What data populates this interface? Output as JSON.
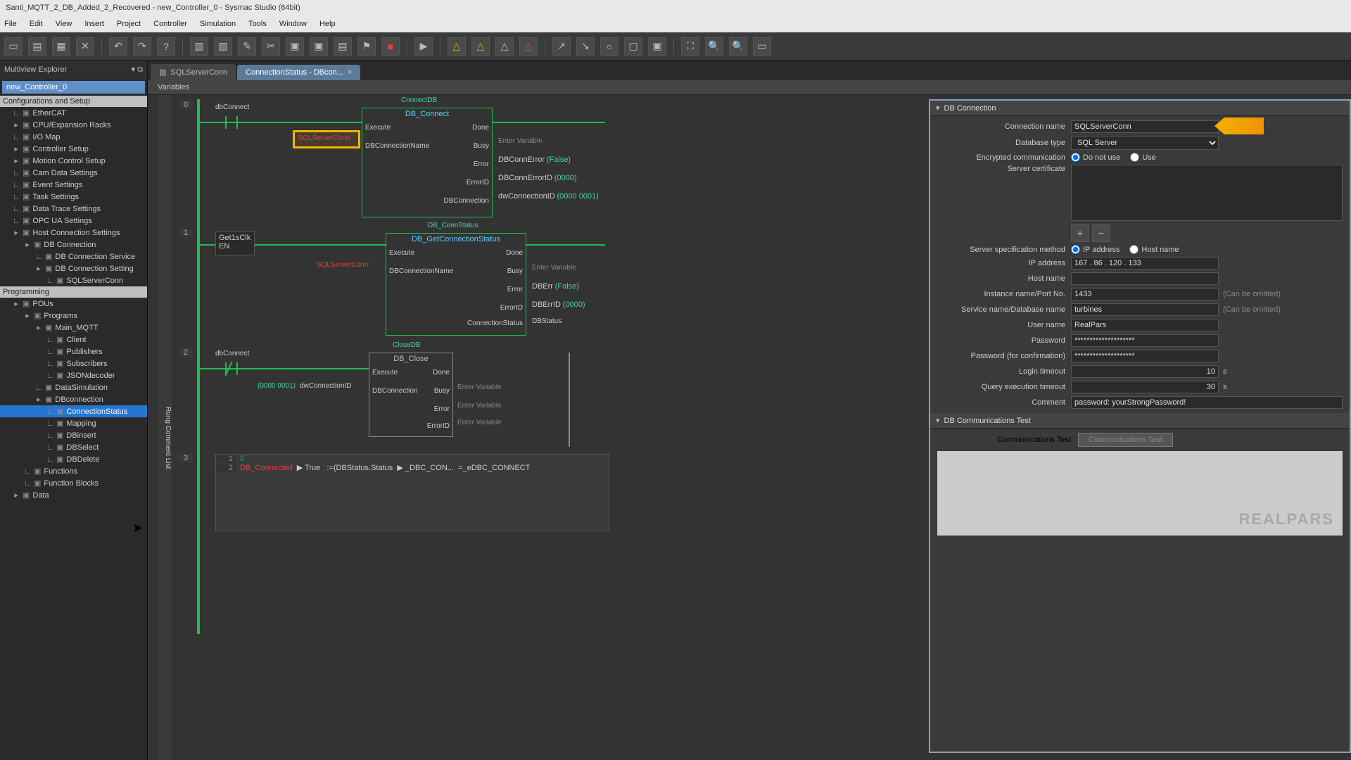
{
  "window": {
    "title": "Santi_MQTT_2_DB_Added_2_Recovered - new_Controller_0 - Sysmac Studio (64bit)"
  },
  "menu": [
    "File",
    "Edit",
    "View",
    "Insert",
    "Project",
    "Controller",
    "Simulation",
    "Tools",
    "Window",
    "Help"
  ],
  "toolbar_icons": [
    "new",
    "open",
    "save",
    "delete",
    "|",
    "undo",
    "redo",
    "help",
    "|",
    "g1",
    "g2",
    "find",
    "cut",
    "cpu",
    "mot",
    "grid",
    "flag",
    "stop",
    "|",
    "play",
    "|",
    "w1",
    "w2",
    "w3",
    "w4",
    "|",
    "a1",
    "a2",
    "circ",
    "sq",
    "chip",
    "|",
    "z1",
    "z2",
    "z3",
    "z4"
  ],
  "explorer": {
    "header": "Multiview Explorer",
    "controller": "new_Controller_0",
    "section1": "Configurations and Setup",
    "items1": [
      {
        "l": "EtherCAT",
        "i": 1
      },
      {
        "l": "CPU/Expansion Racks",
        "i": 1,
        "exp": true
      },
      {
        "l": "I/O Map",
        "i": 1
      },
      {
        "l": "Controller Setup",
        "i": 1,
        "exp": true
      },
      {
        "l": "Motion Control Setup",
        "i": 1,
        "exp": true
      },
      {
        "l": "Cam Data Settings",
        "i": 1
      },
      {
        "l": "Event Settings",
        "i": 1
      },
      {
        "l": "Task Settings",
        "i": 1
      },
      {
        "l": "Data Trace Settings",
        "i": 1
      },
      {
        "l": "OPC UA Settings",
        "i": 1
      },
      {
        "l": "Host Connection Settings",
        "i": 1,
        "exp": true
      },
      {
        "l": "DB Connection",
        "i": 2,
        "exp": true
      },
      {
        "l": "DB Connection Service",
        "i": 3
      },
      {
        "l": "DB Connection Setting",
        "i": 3,
        "exp": true
      },
      {
        "l": "SQLServerConn",
        "i": 4
      }
    ],
    "section2": "Programming",
    "items2": [
      {
        "l": "POUs",
        "i": 1,
        "exp": true
      },
      {
        "l": "Programs",
        "i": 2,
        "exp": true
      },
      {
        "l": "Main_MQTT",
        "i": 3,
        "exp": true
      },
      {
        "l": "Client",
        "i": 4
      },
      {
        "l": "Publishers",
        "i": 4
      },
      {
        "l": "Subscribers",
        "i": 4
      },
      {
        "l": "JSONdecoder",
        "i": 4
      },
      {
        "l": "DataSimulation",
        "i": 3
      },
      {
        "l": "DBconnection",
        "i": 3,
        "exp": true
      },
      {
        "l": "ConnectionStatus",
        "i": 4,
        "sel": true
      },
      {
        "l": "Mapping",
        "i": 4
      },
      {
        "l": "DBinsert",
        "i": 4
      },
      {
        "l": "DBSelect",
        "i": 4
      },
      {
        "l": "DBDelete",
        "i": 4
      },
      {
        "l": "Functions",
        "i": 2
      },
      {
        "l": "Function Blocks",
        "i": 2
      },
      {
        "l": "Data",
        "i": 1,
        "exp": true
      }
    ]
  },
  "tabs": [
    {
      "label": "SQLServerConn",
      "active": false
    },
    {
      "label": "ConnectionStatus - DBcon...",
      "active": true
    }
  ],
  "varbar": "Variables",
  "rung_gutter": "Rung Comment List",
  "ladder": {
    "r0": {
      "num": "0",
      "contact": "dbConnect",
      "block_caption": "ConnectDB",
      "block_name": "DB_Connect",
      "const": "'SQLServerConn'",
      "left": [
        "Execute",
        "DBConnectionName"
      ],
      "right": [
        {
          "p": "Done",
          "v": ""
        },
        {
          "p": "Busy",
          "v": "Enter Variable"
        },
        {
          "p": "Error",
          "v": "DBConnError",
          "x": "(False)"
        },
        {
          "p": "ErrorID",
          "v": "DBConnErrorID",
          "x": "(0000)"
        },
        {
          "p": "DBConnection",
          "v": "dwConnectionID",
          "x": "(0000 0001)"
        }
      ]
    },
    "r1": {
      "num": "1",
      "contact": "Get1sClk",
      "en": "EN",
      "block_caption": "DB_ConnStatus",
      "block_name": "DB_GetConnectionStatus",
      "const": "'SQLServerConn'",
      "left": [
        "Execute",
        "DBConnectionName"
      ],
      "right": [
        {
          "p": "Done",
          "v": ""
        },
        {
          "p": "Busy",
          "v": "Enter Variable"
        },
        {
          "p": "Error",
          "v": "DBErr",
          "x": "(False)"
        },
        {
          "p": "ErrorID",
          "v": "DBErrID",
          "x": "(0000)"
        },
        {
          "p": "ConnectionStatus",
          "v": "DBStatus"
        }
      ]
    },
    "r2": {
      "num": "2",
      "contact": "dbConnect",
      "block_caption": "CloseDB",
      "block_name": "DB_Close",
      "inlabel": "dwConnectionID",
      "inval": "(0000 0001)",
      "left": [
        "Execute",
        "DBConnection"
      ],
      "right": [
        {
          "p": "Done",
          "v": ""
        },
        {
          "p": "Busy",
          "v": "Enter Variable"
        },
        {
          "p": "Error",
          "v": "Enter Variable"
        },
        {
          "p": "ErrorID",
          "v": "Enter Variable"
        }
      ]
    },
    "r3": {
      "num": "3",
      "lines": [
        "//",
        "DB_Connected   ▶ True   :=(DBStatus.Status   ▶ _DBC_CON...   =_eDBC_CONNECT"
      ]
    }
  },
  "db": {
    "header": "DB Connection",
    "fields": {
      "conn_name_l": "Connection name",
      "conn_name": "SQLServerConn",
      "db_type_l": "Database type",
      "db_type": "SQL Server",
      "enc_l": "Encrypted communication",
      "enc_a": "Do not use",
      "enc_b": "Use",
      "cert_l": "Server certificate",
      "spec_l": "Server specification method",
      "spec_a": "IP address",
      "spec_b": "Host name",
      "ip_l": "IP address",
      "ip": "167 . 86 . 120 . 133",
      "host_l": "Host name",
      "host": "",
      "inst_l": "Instance name/Port No.",
      "inst": "1433",
      "inst_h": "(Can be omitted)",
      "svc_l": "Service name/Database name",
      "svc": "turbines",
      "svc_h": "(Can be omitted)",
      "user_l": "User name",
      "user": "RealPars",
      "pass_l": "Password",
      "pass": "********************",
      "pass2_l": "Password (for confirmation)",
      "pass2": "********************",
      "login_l": "Login timeout",
      "login": "10",
      "login_u": "s",
      "query_l": "Query execution timeout",
      "query": "30",
      "query_u": "s",
      "comment_l": "Comment",
      "comment": "password: yourStrongPassword!"
    },
    "comm_header": "DB Communications Test",
    "comm_label": "Communications Test",
    "comm_btn": "Communications Test",
    "watermark": "REALPARS"
  }
}
